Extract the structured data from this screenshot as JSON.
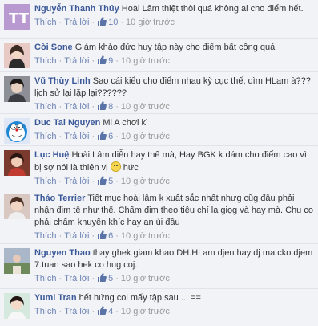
{
  "comments": [
    {
      "author": "Nguyễn Thanh Thúy",
      "text": "Hoài Lâm thiệt thòi quá không ai cho điểm hết.",
      "like_label": "Thích",
      "reply_label": "Trả lời",
      "likes": "10",
      "time": "10 giờ trước"
    },
    {
      "author": "Còi Sone",
      "text": "Giám khảo đức huy tập này cho điểm bất công quá",
      "like_label": "Thích",
      "reply_label": "Trả lời",
      "likes": "9",
      "time": "10 giờ trước"
    },
    {
      "author": "Vũ Thùy Linh",
      "text": "Sao cái kiểu cho điểm nhau kỳ cục thế, dìm HLam à??? lịch sử lại lặp lại??????",
      "like_label": "Thích",
      "reply_label": "Trả lời",
      "likes": "8",
      "time": "10 giờ trước"
    },
    {
      "author": "Duc Tai Nguyen",
      "text": "Mi A chơi kì",
      "like_label": "Thích",
      "reply_label": "Trả lời",
      "likes": "6",
      "time": "10 giờ trước"
    },
    {
      "author": "Lục Huệ",
      "text": "Hoài Lâm diễn hay thế mà, Hay BGK k dám cho điểm cao vì bị sợ nói là thiên vị",
      "text_after": "hức",
      "like_label": "Thích",
      "reply_label": "Trả lời",
      "likes": "5",
      "time": "10 giờ trước"
    },
    {
      "author": "Thảo Terrier",
      "text": "Tiết mục hoài lâm k xuất sắc nhất nhưg cũg đâu phải nhận đim tệ như thế. Chấm đim theo tiêu chí la giọg và hay mà. Chu co phải chấm khuyến khíc hay an ủi đâu",
      "like_label": "Thích",
      "reply_label": "Trả lời",
      "likes": "6",
      "time": "10 giờ trước"
    },
    {
      "author": "Nguyen Thao",
      "text": "thay ghek giam khao DH.HLam djen hay dj ma cko.djem 7.tuan sao hek co hug coj.",
      "like_label": "Thích",
      "reply_label": "Trả lời",
      "likes": "5",
      "time": "10 giờ trước"
    },
    {
      "author": "Yumi Tran",
      "text": "hết hứng coi mấy tập sau ... ==",
      "like_label": "Thích",
      "reply_label": "Trả lời",
      "likes": "4",
      "time": "10 giờ trước"
    }
  ],
  "colors": {
    "author": "#3b5998",
    "meta": "#6d84b4",
    "background": "#f2f3f7"
  },
  "icons": {
    "like": "thumbs-up-icon",
    "emoji": "confused-emoji-icon"
  }
}
